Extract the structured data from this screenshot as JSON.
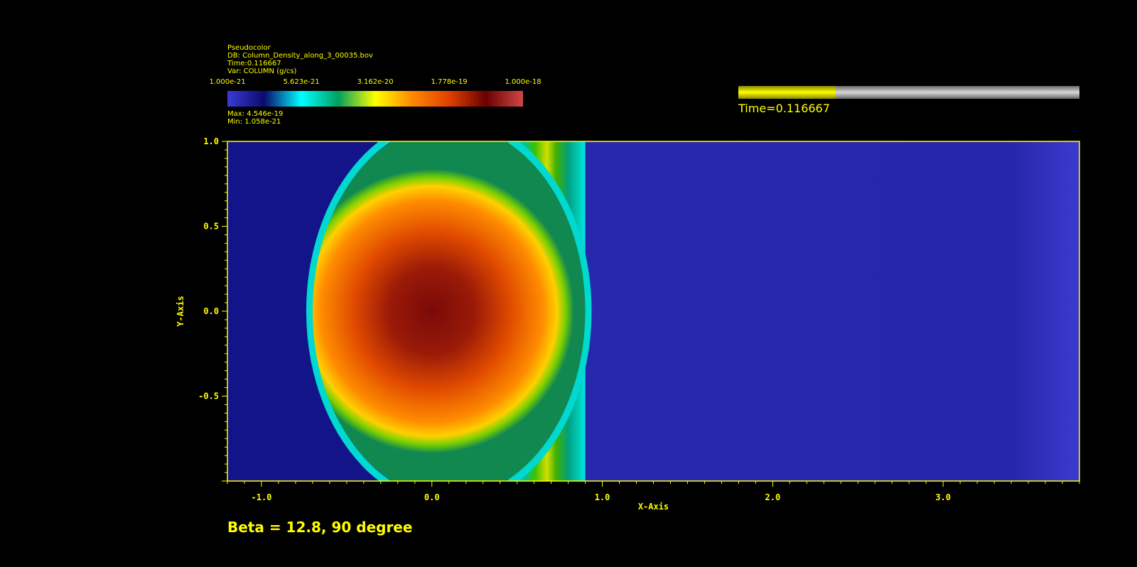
{
  "legend": {
    "plot_type": "Pseudocolor",
    "db": "DB: Column_Density_along_3_00035.bov",
    "time": "Time:0.116667",
    "var": "Var: COLUMN (g/cs)",
    "colorbar_ticks": [
      "1.000e-21",
      "5.623e-21",
      "3.162e-20",
      "1.778e-19",
      "1.000e-18"
    ],
    "max": "Max:  4.546e-19",
    "min": "Min:  1.058e-21",
    "colormap": [
      "#3b3bd6",
      "#0a0a6e",
      "#00ffff",
      "#00a060",
      "#ffff00",
      "#ff8800",
      "#e04000",
      "#6a0000",
      "#d04848"
    ]
  },
  "time_slider": {
    "fraction": 0.286,
    "label": "Time=0.116667",
    "fill_color": "#ffff00",
    "track_color": "#a0a0a0"
  },
  "caption": "Beta = 12.8, 90 degree",
  "chart_data": {
    "type": "heatmap",
    "title": "",
    "xlabel": "X-Axis",
    "ylabel": "Y-Axis",
    "xlim": [
      -1.2,
      3.8
    ],
    "ylim": [
      -1.0,
      1.0
    ],
    "x_ticks": [
      -1.0,
      0.0,
      1.0,
      2.0,
      3.0
    ],
    "x_tick_labels": [
      "-1.0",
      "0.0",
      "1.0",
      "2.0",
      "3.0"
    ],
    "y_ticks": [
      1.0,
      0.5,
      0.0,
      -0.5
    ],
    "y_tick_labels": [
      "1.0",
      "0.5",
      "0.0",
      "-0.5"
    ],
    "background_value_color": "#2424a8",
    "upstream_color": "#14148a",
    "features": {
      "cloud_center": [
        0.0,
        0.0
      ],
      "cloud_left_edge_x": -0.7,
      "shock_front_x": 0.9,
      "cloud_peak_color": "#7a0a08",
      "cloud_edge_color": "#ffd000"
    },
    "axis_color": "#ffff00"
  }
}
